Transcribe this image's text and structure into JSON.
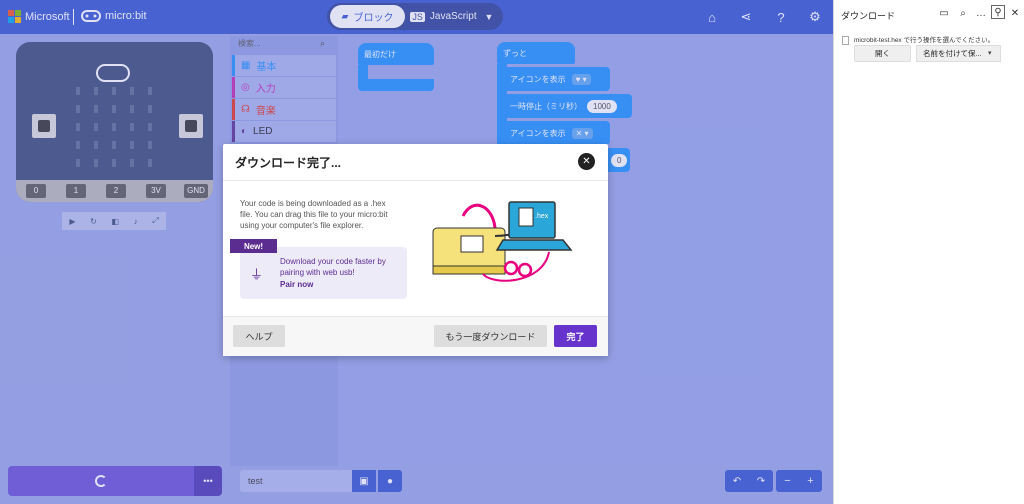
{
  "topbar": {
    "ms_label": "Microsoft",
    "product_label": "micro:bit",
    "tab_blocks": "ブロック",
    "tab_javascript": "JavaScript"
  },
  "simulator": {
    "pins": [
      "0",
      "1",
      "2",
      "3V",
      "GND"
    ]
  },
  "toolbox": {
    "search_placeholder": "検索...",
    "categories": [
      {
        "label": "基本",
        "color": "#1e90ff"
      },
      {
        "label": "入力",
        "color": "#c724b1"
      },
      {
        "label": "音楽",
        "color": "#e63022"
      },
      {
        "label": "LED",
        "color": "#5c2d91"
      }
    ]
  },
  "workspace": {
    "on_start": "最初だけ",
    "forever": "ずっと",
    "show_icon_1": "アイコンを表示",
    "pause": "一時停止（ミリ秒）",
    "pause_value": "1000",
    "show_icon_2": "アイコンを表示",
    "partial_value": "0"
  },
  "dialog": {
    "title": "ダウンロード完了...",
    "body": "Your code is being downloaded as a .hex file. You can drag this file to your micro:bit using your computer's file explorer.",
    "new_badge": "New!",
    "webusb_text": "Download your code faster by pairing with web usb!",
    "pair_link": "Pair now",
    "hex_label": ".hex",
    "help_button": "ヘルプ",
    "redownload_button": "もう一度ダウンロード",
    "done_button": "完了"
  },
  "bottombar": {
    "project_name": "test",
    "more_label": "•••"
  },
  "download_panel": {
    "title": "ダウンロード",
    "file_message": "microbit-test.hex で行う操作を選んでください。",
    "open_button": "開く",
    "save_as_button": "名前を付けて保..."
  },
  "colors": {
    "accent": "#3454d1",
    "purple": "#6633cc",
    "block_blue": "#1e90ff"
  }
}
